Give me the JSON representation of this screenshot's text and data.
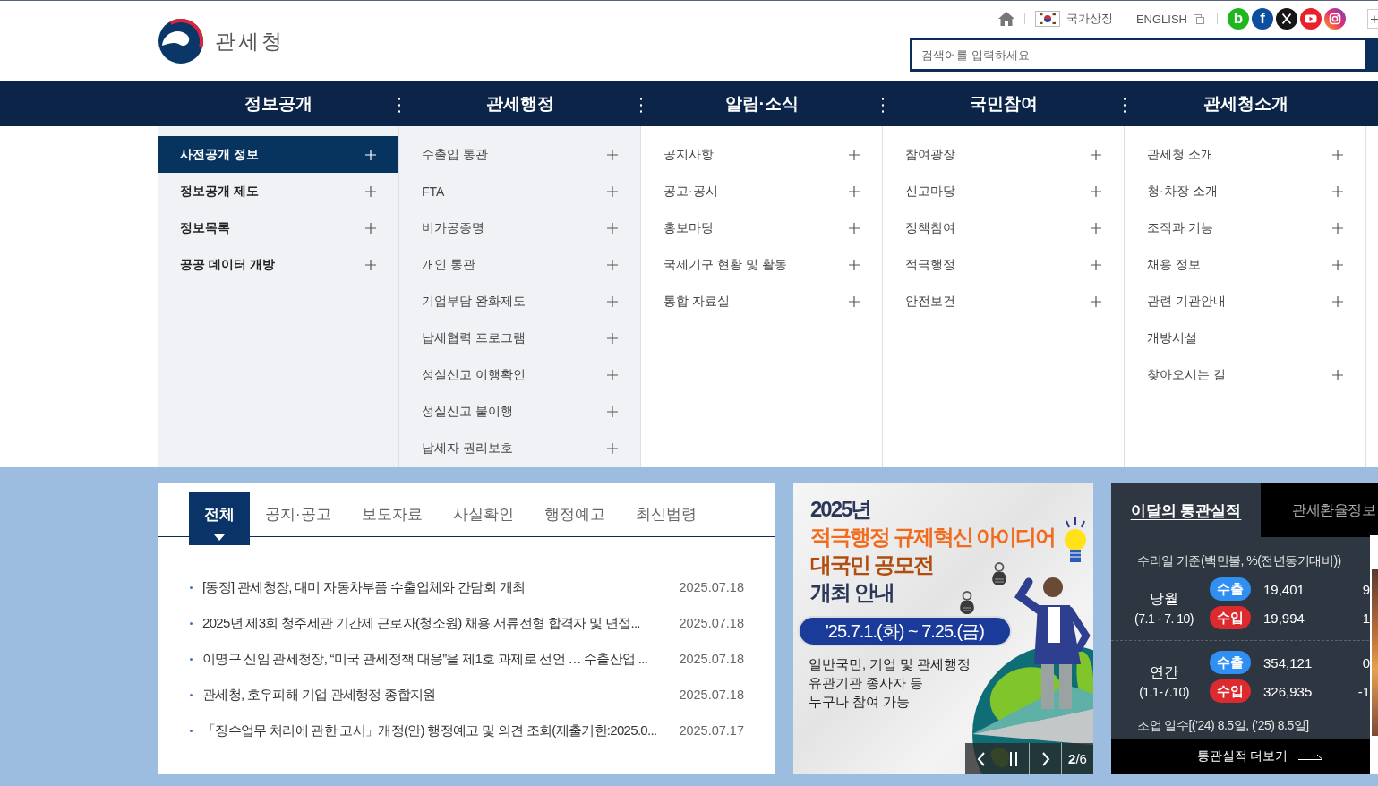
{
  "header": {
    "logo_text": "관세청",
    "national_symbol_link": "국가상징",
    "english_link": "ENGLISH",
    "social_links": [
      {
        "label": "b",
        "color": "#21b51f"
      },
      {
        "label": "f",
        "color": "#0b4f9e"
      }
    ],
    "search": {
      "placeholder": "검색어를 입력하세요"
    }
  },
  "nav": [
    {
      "label": "정보공개",
      "shaded": true,
      "selected": true,
      "items": [
        {
          "label": "사전공개 정보",
          "selected": true,
          "expandable": true
        },
        {
          "label": "정보공개 제도",
          "selected": false,
          "expandable": true
        },
        {
          "label": "정보목록",
          "selected": false,
          "expandable": true
        },
        {
          "label": "공공 데이터 개방",
          "selected": false,
          "expandable": true
        }
      ]
    },
    {
      "label": "관세행정",
      "shaded": true,
      "selected": false,
      "items": [
        {
          "label": "수출입 통관",
          "selected": false,
          "expandable": true
        },
        {
          "label": "FTA",
          "selected": false,
          "expandable": true
        },
        {
          "label": "비가공증명",
          "selected": false,
          "expandable": true
        },
        {
          "label": "개인 통관",
          "selected": false,
          "expandable": true
        },
        {
          "label": "기업부담 완화제도",
          "selected": false,
          "expandable": true
        },
        {
          "label": "납세협력 프로그램",
          "selected": false,
          "expandable": true
        },
        {
          "label": "성실신고 이행확인",
          "selected": false,
          "expandable": true
        },
        {
          "label": "성실신고 불이행",
          "selected": false,
          "expandable": true
        },
        {
          "label": "납세자 권리보호",
          "selected": false,
          "expandable": true
        }
      ]
    },
    {
      "label": "알림·소식",
      "shaded": false,
      "selected": false,
      "items": [
        {
          "label": "공지사항",
          "selected": false,
          "expandable": true
        },
        {
          "label": "공고·공시",
          "selected": false,
          "expandable": true
        },
        {
          "label": "홍보마당",
          "selected": false,
          "expandable": true
        },
        {
          "label": "국제기구 현황 및 활동",
          "selected": false,
          "expandable": true
        },
        {
          "label": "통합 자료실",
          "selected": false,
          "expandable": true
        }
      ]
    },
    {
      "label": "국민참여",
      "shaded": false,
      "selected": false,
      "items": [
        {
          "label": "참여광장",
          "selected": false,
          "expandable": true
        },
        {
          "label": "신고마당",
          "selected": false,
          "expandable": true
        },
        {
          "label": "정책참여",
          "selected": false,
          "expandable": true
        },
        {
          "label": "적극행정",
          "selected": false,
          "expandable": true
        },
        {
          "label": "안전보건",
          "selected": false,
          "expandable": true
        }
      ]
    },
    {
      "label": "관세청소개",
      "shaded": false,
      "selected": false,
      "items": [
        {
          "label": "관세청 소개",
          "selected": false,
          "expandable": true
        },
        {
          "label": "청·차장 소개",
          "selected": false,
          "expandable": true
        },
        {
          "label": "조직과 기능",
          "selected": false,
          "expandable": true
        },
        {
          "label": "채용 정보",
          "selected": false,
          "expandable": true
        },
        {
          "label": "관련 기관안내",
          "selected": false,
          "expandable": true
        },
        {
          "label": "개방시설",
          "selected": false,
          "expandable": false
        },
        {
          "label": "찾아오시는 길",
          "selected": false,
          "expandable": true
        }
      ]
    }
  ],
  "notice_tabs": [
    {
      "label": "전체",
      "selected": true
    },
    {
      "label": "공지·공고",
      "selected": false
    },
    {
      "label": "보도자료",
      "selected": false
    },
    {
      "label": "사실확인",
      "selected": false
    },
    {
      "label": "행정예고",
      "selected": false
    },
    {
      "label": "최신법령",
      "selected": false
    }
  ],
  "notices": [
    {
      "title": "[동정] 관세청장, 대미 자동차부품 수출업체와 간담회 개최",
      "date": "2025.07.18"
    },
    {
      "title": "2025년 제3회 청주세관 기간제 근로자(청소원) 채용 서류전형 합격자 및 면접...",
      "date": "2025.07.18"
    },
    {
      "title": "이명구 신임 관세청장, “미국 관세정책 대응”을 제1호 과제로 선언 … 수출산업 ...",
      "date": "2025.07.18"
    },
    {
      "title": "관세청, 호우피해 기업 관세행정 종합지원",
      "date": "2025.07.18"
    },
    {
      "title": "「징수업무 처리에 관한 고시」개정(안) 행정예고 및 의견 조회(제출기한:2025.0...",
      "date": "2025.07.17"
    }
  ],
  "banner": {
    "title_lines": [
      {
        "text": "2025년",
        "color": "#2a3758"
      },
      {
        "text": "적극행정 규제혁신 아이디어",
        "color": "#f26a1b"
      },
      {
        "text": "대국민 공모전",
        "color": "#b14c0c"
      },
      {
        "text": "개최 안내",
        "color": "#2a3758"
      }
    ],
    "period": "'25.7.1.(화) ~ 7.25.(금)",
    "description_lines": [
      "일반국민, 기업 및 관세행정",
      "유관기관 종사자 등",
      "누구나 참여 가능"
    ],
    "counter": "**2**/6"
  },
  "stats": {
    "tabs": [
      {
        "label": "이달의 통관실적",
        "selected": true
      },
      {
        "label": "관세환율정보",
        "selected": false
      }
    ],
    "basis": "수리일 기준(백만불, %(전년동기대비))",
    "groups": [
      {
        "label": "당월",
        "period": "(7.1 - 7. 10)",
        "rows": [
          {
            "badge": "수출",
            "color": "#2f8ff2",
            "value": "19,401",
            "rate": "9"
          },
          {
            "badge": "수입",
            "color": "#dd2a2e",
            "value": "19,994",
            "rate": "1"
          }
        ]
      },
      {
        "label": "연간",
        "period": "(1.1-7.10)",
        "rows": [
          {
            "badge": "수출",
            "color": "#2f8ff2",
            "value": "354,121",
            "rate": "0"
          },
          {
            "badge": "수입",
            "color": "#dd2a2e",
            "value": "326,935",
            "rate": "-1"
          }
        ]
      }
    ],
    "work_days": "조업 일수[(’24) 8.5일, (’25) 8.5일]",
    "more_link": "통관실적 더보기"
  }
}
